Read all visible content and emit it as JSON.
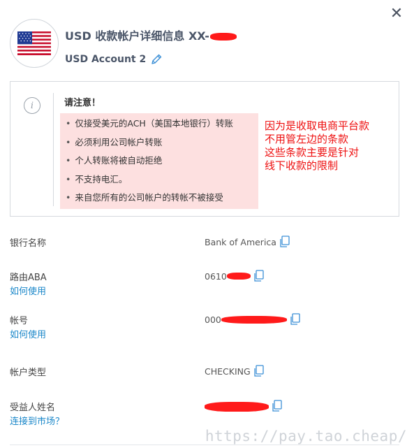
{
  "dialog": {
    "title_prefix": "USD 收款帐户详细信息 XX-",
    "subtitle": "USD Account 2"
  },
  "notice": {
    "title": "请注意！",
    "items": [
      "仅接受美元的ACH（美国本地银行）转账",
      "必须利用公司帐户转账",
      "个人转账将被自动拒绝",
      "不支持电汇。",
      "来自您所有的公司帐户的转帐不被接受"
    ]
  },
  "annotation": "因为是收取电商平台款\n不用管左边的条款\n这些条款主要是针对\n线下收款的限制",
  "fields": {
    "bank_name": {
      "label": "银行名称",
      "value": "Bank of America"
    },
    "routing": {
      "label": "路由ABA",
      "value": "0610",
      "link": "如何使用"
    },
    "account_no": {
      "label": "帐号",
      "value": "000",
      "link": "如何使用"
    },
    "account_type": {
      "label": "帐户类型",
      "value": "CHECKING"
    },
    "beneficiary": {
      "label": "受益人姓名",
      "link": "连接到市场？"
    }
  },
  "watermark": "https://pay.tao.cheap/",
  "icons": {
    "close": "close-icon",
    "flag": "us-flag-icon",
    "edit": "pencil-icon",
    "info": "info-icon",
    "copy": "copy-icon"
  },
  "colors": {
    "link": "#1a87c9",
    "redaction": "#ff1a1a",
    "notice_bg": "#fde0e0",
    "annotation": "#ee1111"
  }
}
